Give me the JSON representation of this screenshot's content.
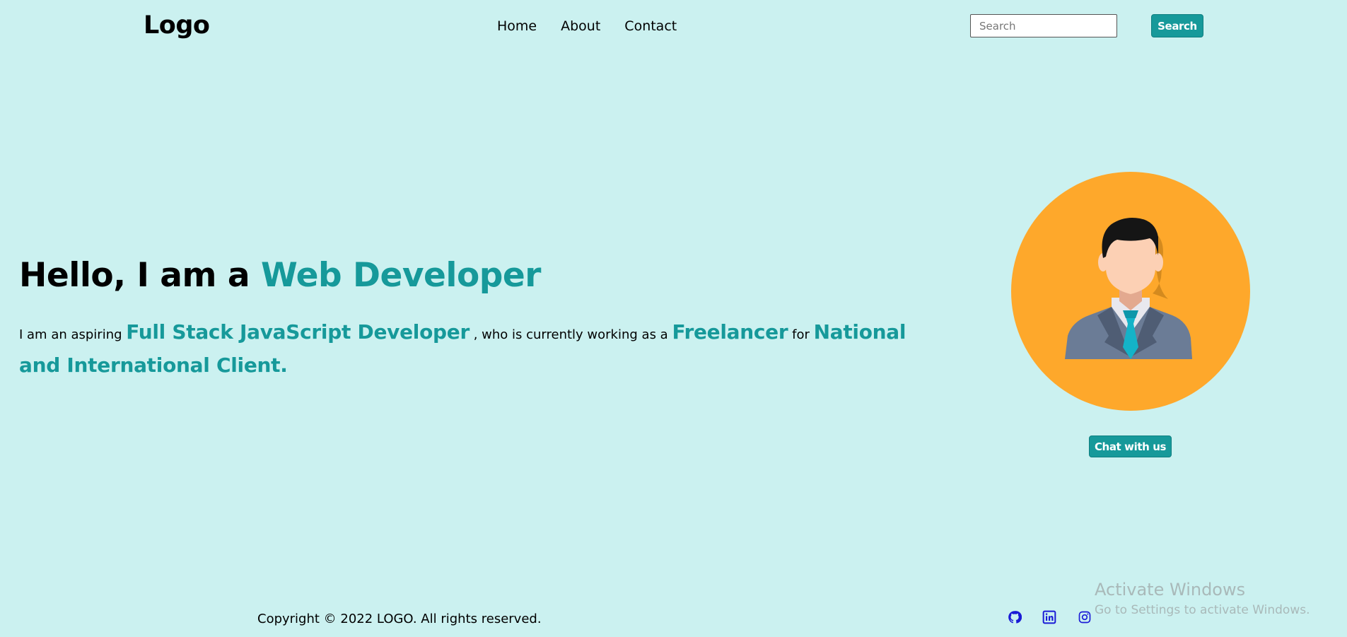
{
  "header": {
    "logo": "Logo",
    "nav": [
      {
        "label": "Home"
      },
      {
        "label": "About"
      },
      {
        "label": "Contact"
      }
    ],
    "search_placeholder": "Search",
    "search_button": "Search"
  },
  "hero": {
    "title_prefix": "Hello, I am a",
    "title_accent": "Web Developer",
    "text_1": "I am an aspiring",
    "hl_1": "Full Stack JavaScript Developer",
    "text_2": ", who is currently working as a",
    "hl_2": "Freelancer",
    "text_3": "for",
    "hl_3": "National and International Client."
  },
  "avatar": {
    "icon": "businessman-avatar-icon",
    "chat_button": "Chat with us"
  },
  "footer": {
    "copyright": "Copyright © 2022 LOGO. All rights reserved.",
    "social_icons": [
      "github-icon",
      "linkedin-icon",
      "instagram-icon"
    ]
  },
  "watermark": {
    "title": "Activate Windows",
    "subtitle": "Go to Settings to activate Windows."
  },
  "colors": {
    "background": "#cbf1f0",
    "accent": "#16999a",
    "avatar_bg": "#fea82b",
    "social_icon": "#1a1ad6"
  }
}
